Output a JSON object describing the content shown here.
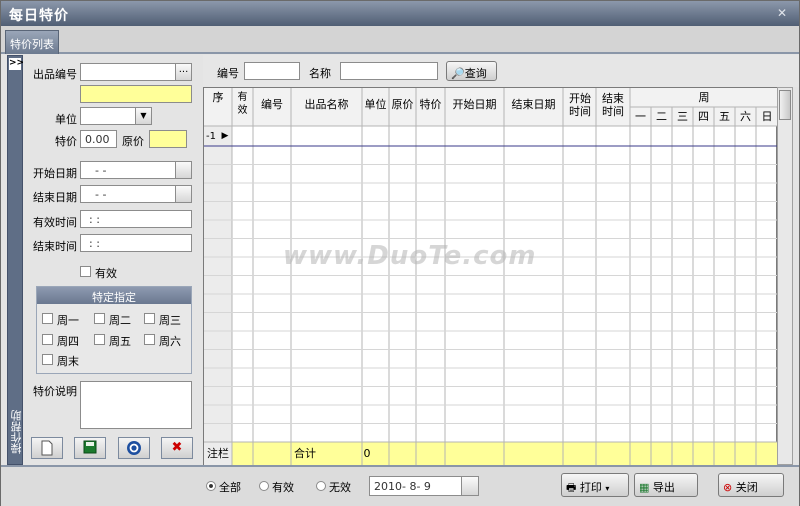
{
  "window": {
    "title": "每日特价",
    "close_glyph": "✕"
  },
  "tabs": [
    {
      "label": "特价列表"
    }
  ],
  "side_strip": {
    "expand_glyph": ">>",
    "label": "操作帮助"
  },
  "form": {
    "product_no_label": "出品编号",
    "browse_label": "...",
    "unit_label": "单位",
    "special_price_label": "特价",
    "special_price_value": "0.00",
    "original_price_label": "原价",
    "start_date_label": "开始日期",
    "start_date_value": "- -",
    "end_date_label": "结束日期",
    "end_date_value": "- -",
    "valid_time_label": "有效时间",
    "valid_time_value": ": :",
    "end_time_label": "结束时间",
    "end_time_value": ": :",
    "valid_label": "有效",
    "designate_header": "特定指定",
    "weekdays": [
      "周一",
      "周二",
      "周三",
      "周四",
      "周五",
      "周六",
      "周末"
    ],
    "description_label": "特价说明"
  },
  "toolbar_icons": [
    "new-icon",
    "save-icon",
    "refresh-icon",
    "delete-icon"
  ],
  "search": {
    "no_label": "编号",
    "name_label": "名称",
    "query_button": "查询"
  },
  "table": {
    "columns": [
      "序",
      "有效",
      "编号",
      "出品名称",
      "单位",
      "原价",
      "特价",
      "开始日期",
      "结束日期",
      "开始时间",
      "结束时间"
    ],
    "week_header": "周",
    "week_days": [
      "一",
      "二",
      "三",
      "四",
      "五",
      "六",
      "日"
    ],
    "first_row": {
      "seq": "-1",
      "indicator": "▶"
    },
    "footer": {
      "label": "注栏",
      "sum_label": "合计",
      "sum_value": "0"
    }
  },
  "watermark": "www.DuoTe.com",
  "bottom": {
    "filters": [
      "全部",
      "有效",
      "无效"
    ],
    "selected_filter": "全部",
    "date_value": "2010- 8- 9",
    "print_label": "打印",
    "export_label": "导出",
    "close_label": "关闭"
  }
}
